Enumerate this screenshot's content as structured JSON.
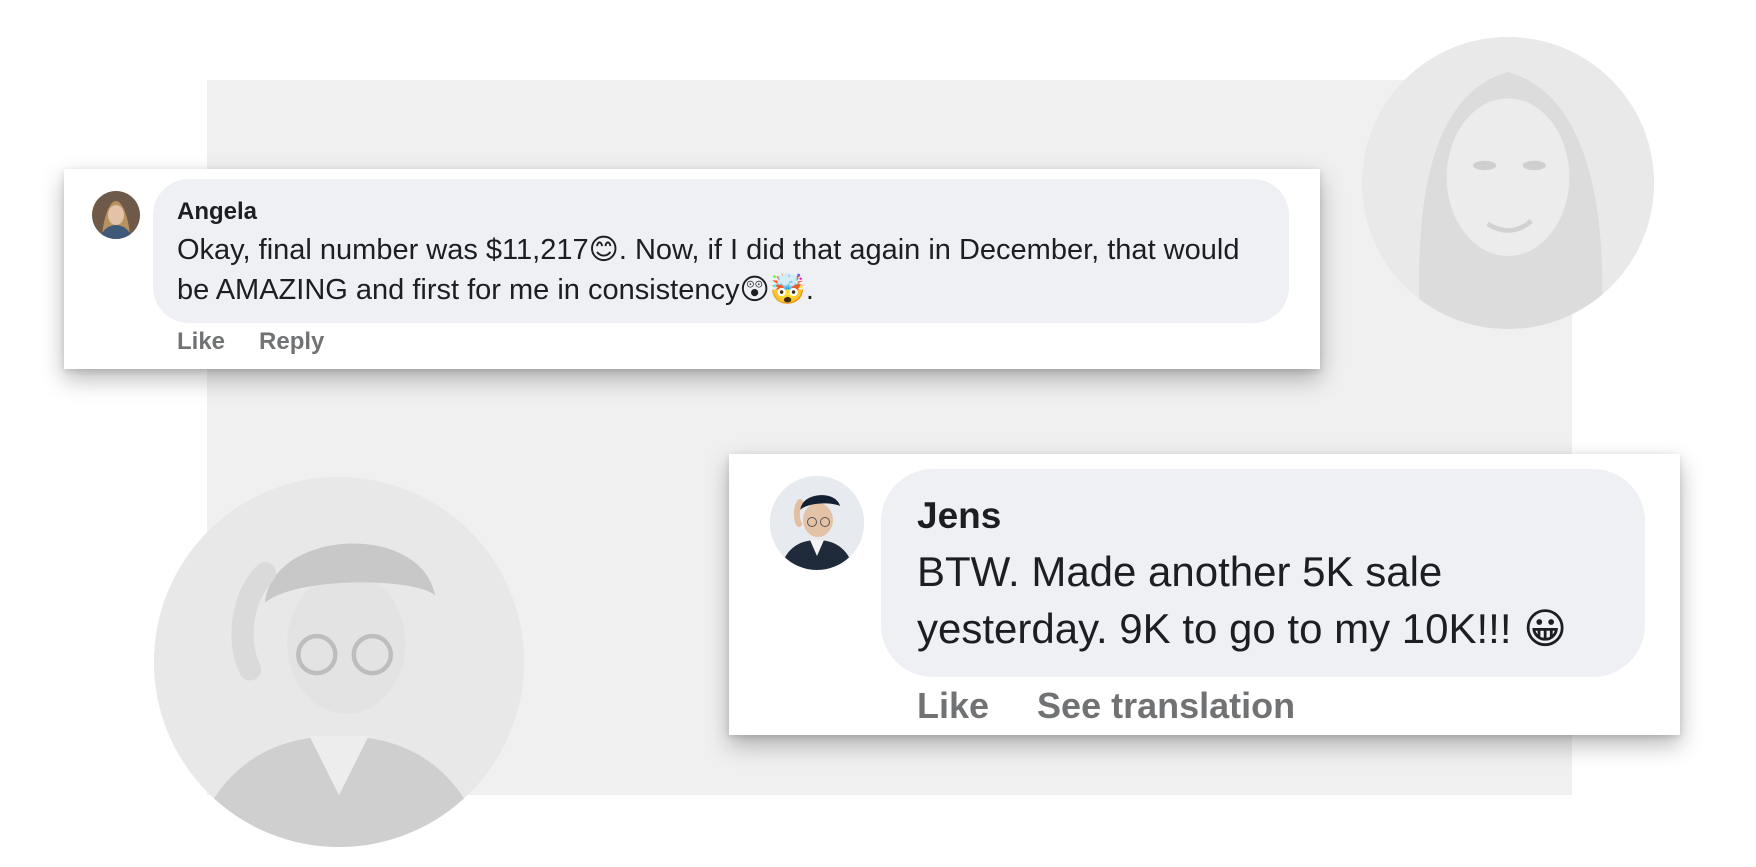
{
  "comments": [
    {
      "author": "Angela",
      "text": "Okay, final number was $11,217😊. Now, if I did that again in December, that would be AMAZING and first for me in consistency😲🤯.",
      "actions": [
        "Like",
        "Reply"
      ]
    },
    {
      "author": "Jens",
      "text": "BTW. Made another 5K sale yesterday. 9K to go to my 10K!!! 😀",
      "actions": [
        "Like",
        "See translation"
      ]
    }
  ],
  "icons": {
    "angela_avatar": "avatar-woman-photo",
    "jens_avatar": "avatar-man-cap-photo",
    "background_woman": "woman-portrait-faded",
    "background_man": "man-portrait-faded"
  },
  "colors": {
    "bubble": "#eef0f3",
    "action_text": "#707274",
    "panel": "#f0f0f0"
  }
}
